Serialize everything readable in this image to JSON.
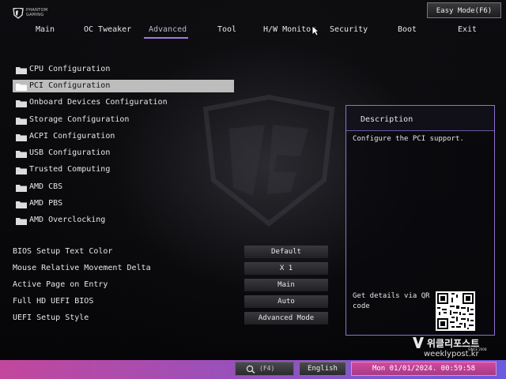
{
  "brand": {
    "line1": "PHANTOM",
    "line2": "GAMING"
  },
  "easy_mode_label": "Easy Mode(F6)",
  "tabs": [
    {
      "label": "Main"
    },
    {
      "label": "OC Tweaker"
    },
    {
      "label": "Advanced",
      "active": true
    },
    {
      "label": "Tool"
    },
    {
      "label": "H/W Monitor"
    },
    {
      "label": "Security"
    },
    {
      "label": "Boot"
    },
    {
      "label": "Exit"
    }
  ],
  "menu": [
    {
      "label": "CPU Configuration"
    },
    {
      "label": "PCI Configuration",
      "selected": true
    },
    {
      "label": "Onboard Devices Configuration"
    },
    {
      "label": "Storage Configuration"
    },
    {
      "label": "ACPI Configuration"
    },
    {
      "label": "USB Configuration"
    },
    {
      "label": "Trusted Computing"
    },
    {
      "label": "AMD CBS"
    },
    {
      "label": "AMD PBS"
    },
    {
      "label": "AMD Overclocking"
    }
  ],
  "settings": [
    {
      "label": "BIOS Setup Text Color",
      "value": "Default"
    },
    {
      "label": "Mouse Relative Movement Delta",
      "value": "X 1"
    },
    {
      "label": "Active Page on Entry",
      "value": "Main"
    },
    {
      "label": "Full HD UEFI BIOS",
      "value": "Auto"
    },
    {
      "label": "UEFI Setup Style",
      "value": "Advanced Mode"
    }
  ],
  "description": {
    "title": "Description",
    "text": "Configure the PCI support.",
    "qr_caption": "Get details via QR code"
  },
  "watermark": {
    "name": "위클리포스트",
    "since": "SINCE 2008",
    "url": "weeklypost.kr"
  },
  "bottom": {
    "search_key": "(F4)",
    "language": "English",
    "datetime": "Mon 01/01/2024. 00:59:58"
  },
  "colors": {
    "accent": "#9e7be0",
    "selected_row": "#bdbdbd",
    "bottom_left": "#c2479c",
    "bottom_right": "#6a5be0"
  }
}
